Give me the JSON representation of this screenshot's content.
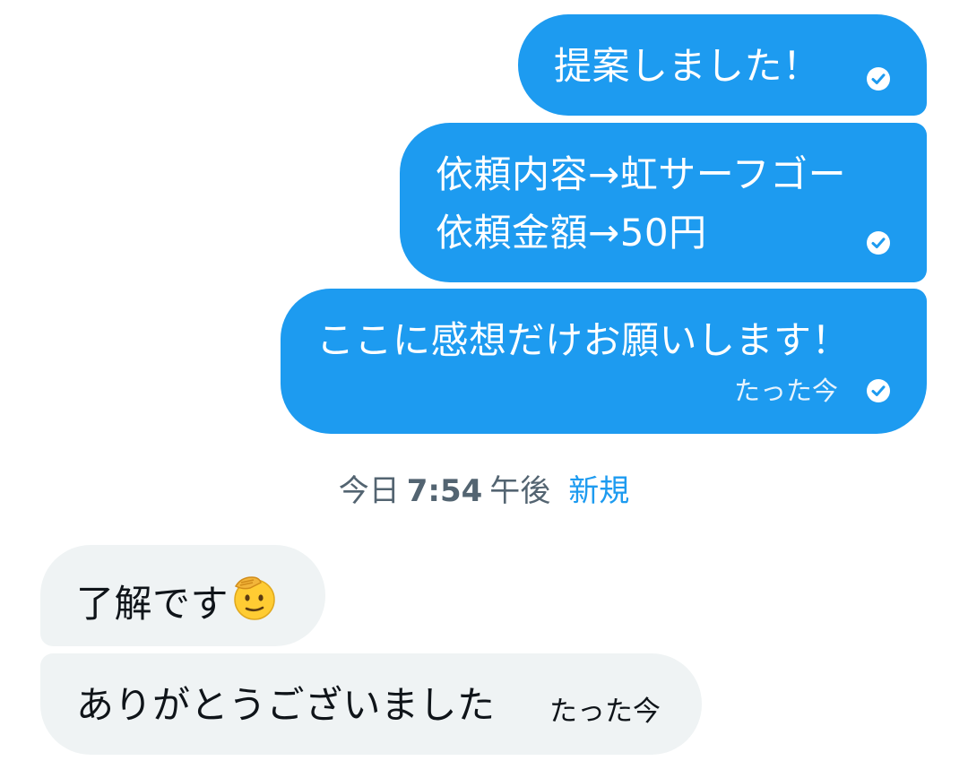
{
  "conversation": {
    "sent_messages": [
      {
        "lines": [
          "提案しました！"
        ],
        "status_icon": "check-circle-icon"
      },
      {
        "lines": [
          "依頼内容→虹サーフゴー",
          "依頼金額→50円"
        ],
        "status_icon": "check-circle-icon"
      },
      {
        "lines": [
          "ここに感想だけお願いします！"
        ],
        "timestamp": "たった今",
        "status_icon": "check-circle-icon"
      }
    ],
    "divider": {
      "day": "今日",
      "time": "7:54",
      "ampm": "午後",
      "new_label": "新規"
    },
    "received_messages": [
      {
        "text": "了解です",
        "emoji": "saluting-face-icon"
      },
      {
        "text": "ありがとうございました",
        "timestamp": "たった今"
      }
    ]
  },
  "colors": {
    "sent_bubble": "#1d9bf0",
    "received_bubble": "#eff3f4",
    "new_label": "#1d9bf0",
    "divider_text": "#536471"
  }
}
